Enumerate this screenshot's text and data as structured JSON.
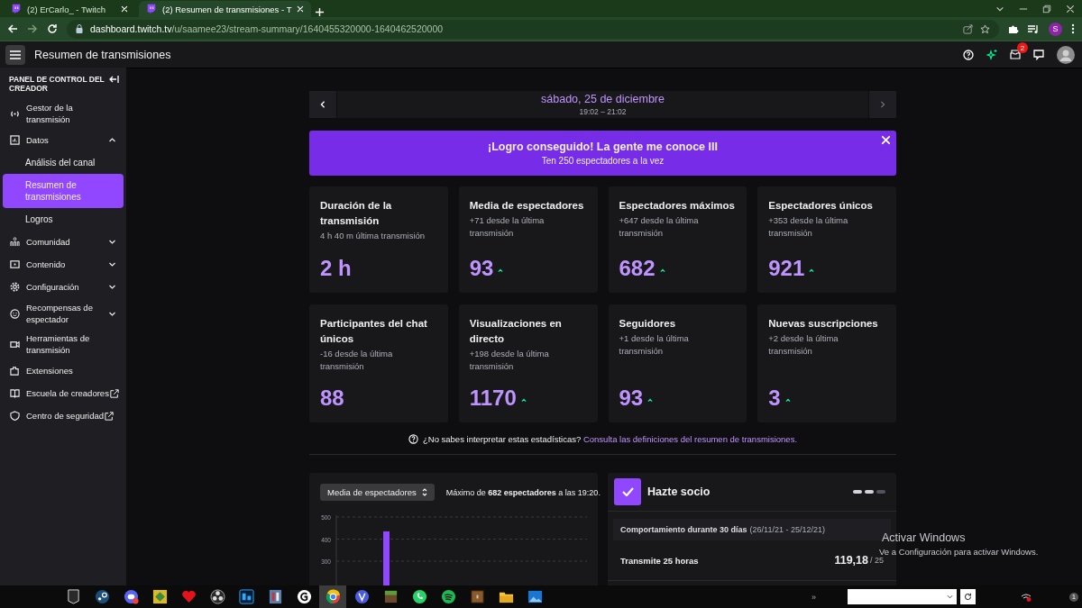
{
  "browser": {
    "tabs": [
      {
        "title": "(2) ErCarlo_ - Twitch",
        "selected": false
      },
      {
        "title": "(2) Resumen de transmisiones - T",
        "selected": true
      }
    ],
    "url": "**dashboard.twitch.tv**/u/saamee23/stream-summary/1640455320000-1640462520000",
    "profile_initial": "S"
  },
  "topbar": {
    "title": "Resumen de transmisiones",
    "inbox_count": "2"
  },
  "sidebar": {
    "title": "PANEL DE CONTROL DEL CREADOR",
    "items": [
      {
        "label": "Gestor de la transmisión",
        "kind": "link"
      },
      {
        "label": "Datos",
        "kind": "group",
        "expanded": true,
        "children": [
          {
            "label": "Análisis del canal",
            "selected": false
          },
          {
            "label": "Resumen de transmisiones",
            "selected": true
          },
          {
            "label": "Logros",
            "selected": false
          }
        ]
      },
      {
        "label": "Comunidad",
        "kind": "group",
        "expanded": false
      },
      {
        "label": "Contenido",
        "kind": "group",
        "expanded": false
      },
      {
        "label": "Configuración",
        "kind": "group",
        "expanded": false
      },
      {
        "label": "Recompensas de espectador",
        "kind": "group",
        "expanded": false
      },
      {
        "label": "Herramientas de transmisión",
        "kind": "link"
      },
      {
        "label": "Extensiones",
        "kind": "link"
      },
      {
        "label": "Escuela de creadores",
        "kind": "external"
      },
      {
        "label": "Centro de seguridad",
        "kind": "external"
      }
    ]
  },
  "date_nav": {
    "date": "sábado, 25 de diciembre",
    "time": "19:02 – 21:02"
  },
  "banner": {
    "title": "¡Logro conseguido! La gente me conoce III",
    "subtitle": "Ten 250 espectadores a la vez"
  },
  "stats": [
    {
      "title": "Duración de la transmisión",
      "delta": "4 h 40 m última transmisión",
      "value": "2 h",
      "trend_up": false
    },
    {
      "title": "Media de espectadores",
      "delta": "+71 desde la última transmisión",
      "value": "93",
      "trend_up": true
    },
    {
      "title": "Espectadores máximos",
      "delta": "+647 desde la última transmisión",
      "value": "682",
      "trend_up": true
    },
    {
      "title": "Espectadores únicos",
      "delta": "+353 desde la última transmisión",
      "value": "921",
      "trend_up": true
    },
    {
      "title": "Participantes del chat únicos",
      "delta": "-16 desde la última transmisión",
      "value": "88",
      "trend_up": false
    },
    {
      "title": "Visualizaciones en directo",
      "delta": "+198 desde la última transmisión",
      "value": "1170",
      "trend_up": true
    },
    {
      "title": "Seguidores",
      "delta": "+1 desde la última transmisión",
      "value": "93",
      "trend_up": true
    },
    {
      "title": "Nuevas suscripciones",
      "delta": "+2 desde la última transmisión",
      "value": "3",
      "trend_up": true
    }
  ],
  "help": {
    "question": "¿No sabes interpretar estas estadísticas?",
    "link": "Consulta las definiciones del resumen de transmisiones."
  },
  "viewer_chart": {
    "metric": "Media de espectadores",
    "peak": "Máximo de **682 espectadores** a las 19:20.",
    "chart_data": {
      "type": "bar",
      "values": [
        435
      ],
      "ylim": [
        0,
        500
      ],
      "yticks": [
        300,
        400,
        500
      ]
    }
  },
  "partner": {
    "title": "Hazte socio",
    "pages": [
      {
        "selected": true
      },
      {
        "selected": true
      },
      {
        "selected": false
      }
    ],
    "period": "Comportamiento durante 30 días",
    "period_range": "(26/11/21 - 25/12/21)",
    "requirement": {
      "label": "Transmite 25 horas",
      "value": "119,18",
      "target": "/ 25"
    }
  },
  "windows_notice": {
    "title": "Activar Windows",
    "subtitle": "Ve a Configuración para activar Windows."
  },
  "taskbar": {
    "apps": [
      {
        "selected": false
      },
      {
        "selected": false
      },
      {
        "selected": false
      },
      {
        "selected": false
      },
      {
        "selected": false
      },
      {
        "selected": false
      },
      {
        "selected": false
      },
      {
        "selected": false
      },
      {
        "selected": false
      },
      {
        "selected": true
      },
      {
        "selected": false
      },
      {
        "selected": false
      },
      {
        "selected": false
      },
      {
        "selected": false
      },
      {
        "selected": false
      },
      {
        "selected": false
      },
      {
        "selected": false
      }
    ],
    "overflow": "»",
    "notification_count": "1"
  }
}
